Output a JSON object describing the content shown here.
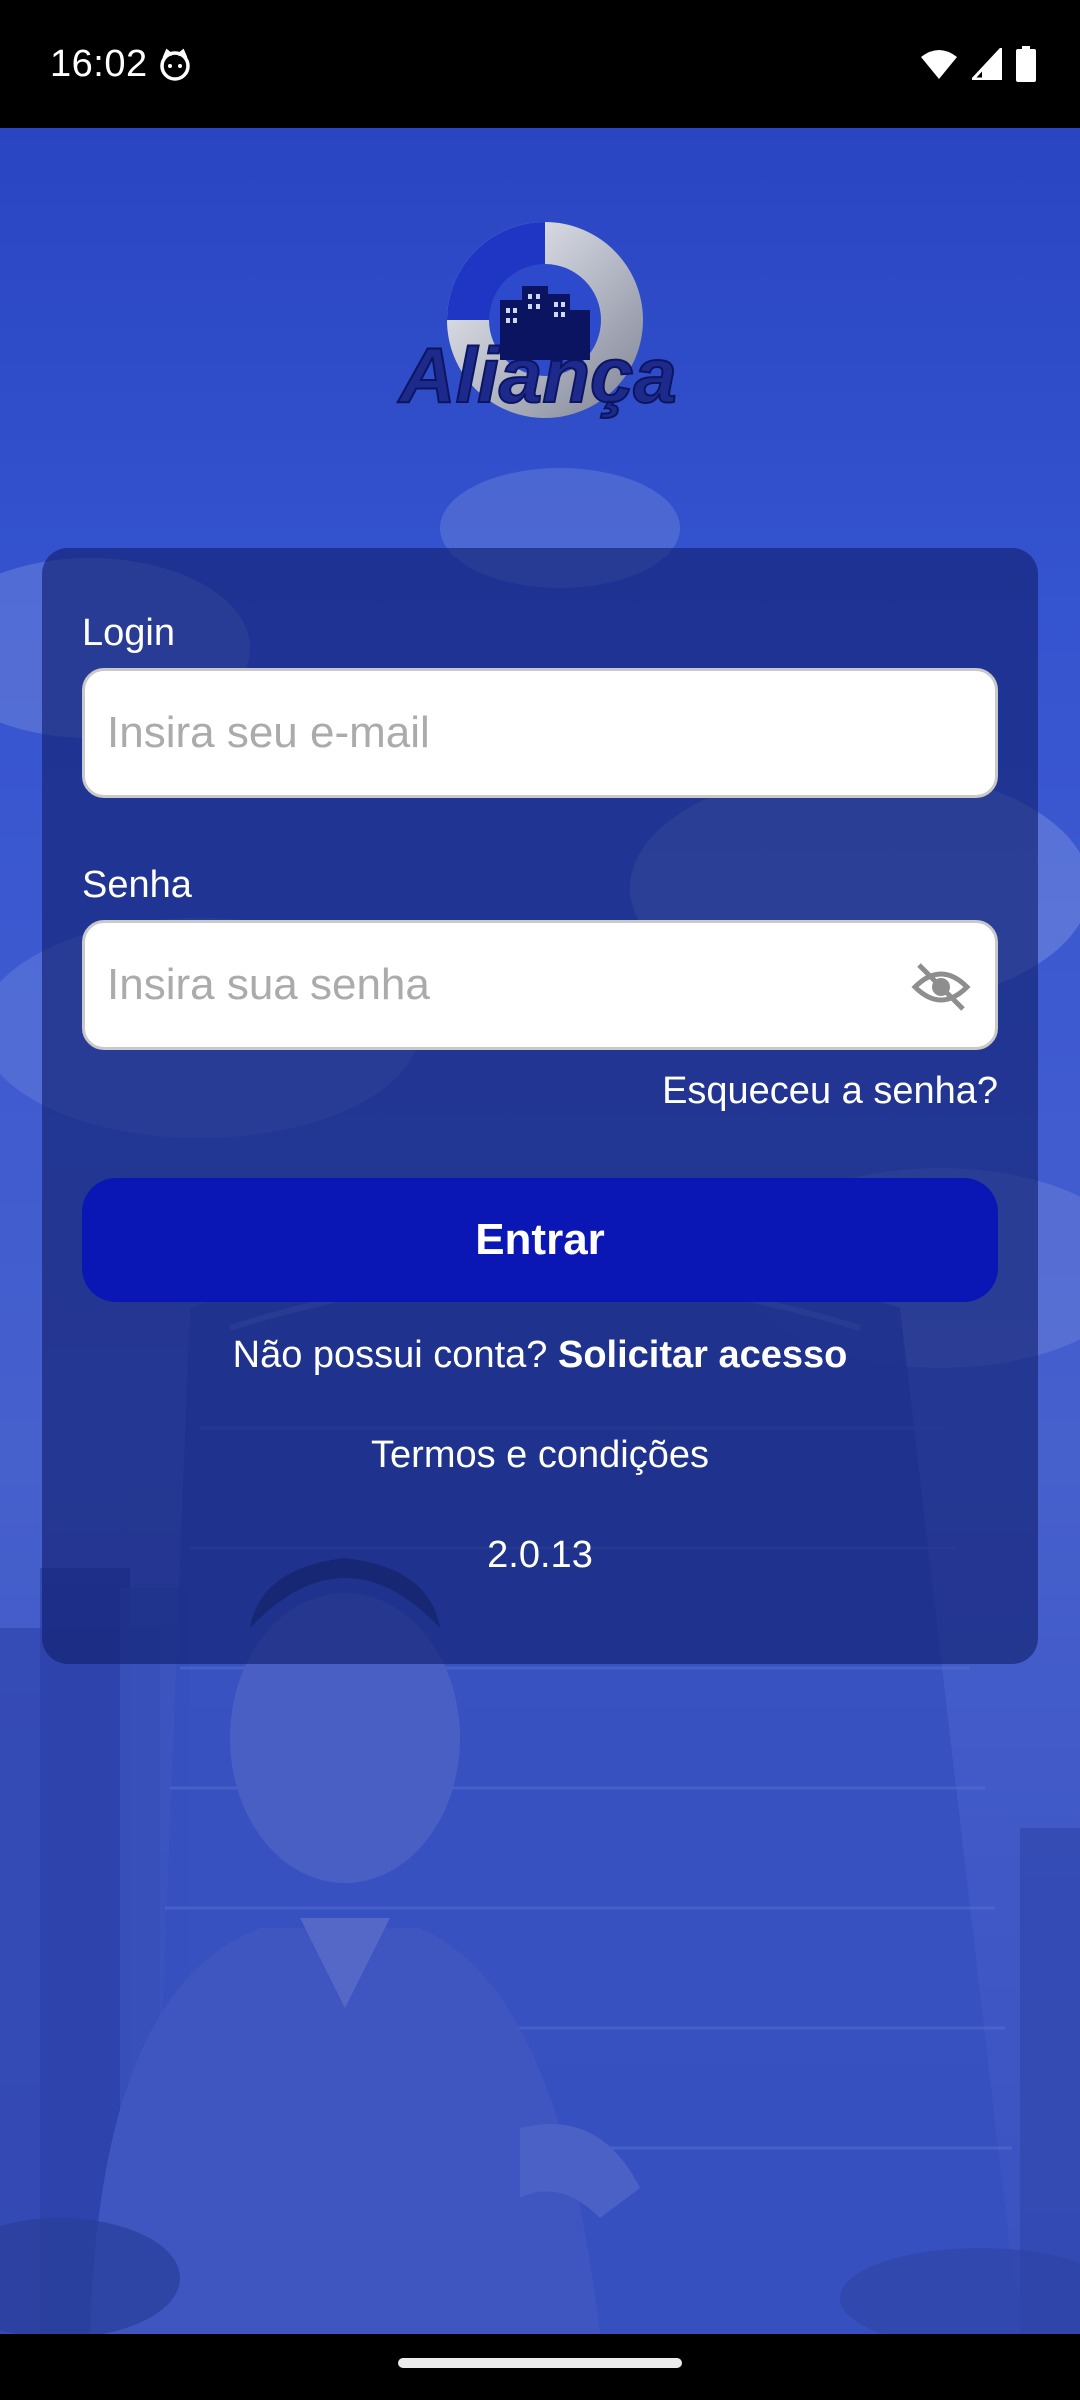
{
  "status_bar": {
    "time": "16:02",
    "icons": [
      "cat-notification-icon",
      "wifi-icon",
      "cellular-signal-icon",
      "battery-icon"
    ]
  },
  "logo": {
    "text": "Aliança",
    "colors": {
      "navy": "#1d2a8c",
      "silver": "#c9ccd6",
      "blue": "#2038c8"
    }
  },
  "form": {
    "login": {
      "label": "Login",
      "placeholder": "Insira seu e-mail",
      "value": ""
    },
    "password": {
      "label": "Senha",
      "placeholder": "Insira sua senha",
      "value": "",
      "visibility_icon": "eye-off-icon"
    },
    "forgot_password": "Esqueceu a senha?",
    "submit_label": "Entrar",
    "no_account_text": "Não possui conta?",
    "request_access_label": "Solicitar acesso",
    "terms_label": "Termos e condições",
    "version": "2.0.13"
  },
  "colors": {
    "primary_button": "#0b17b5",
    "background_blue": "#3a55cc",
    "card_overlay": "#101e6e"
  }
}
